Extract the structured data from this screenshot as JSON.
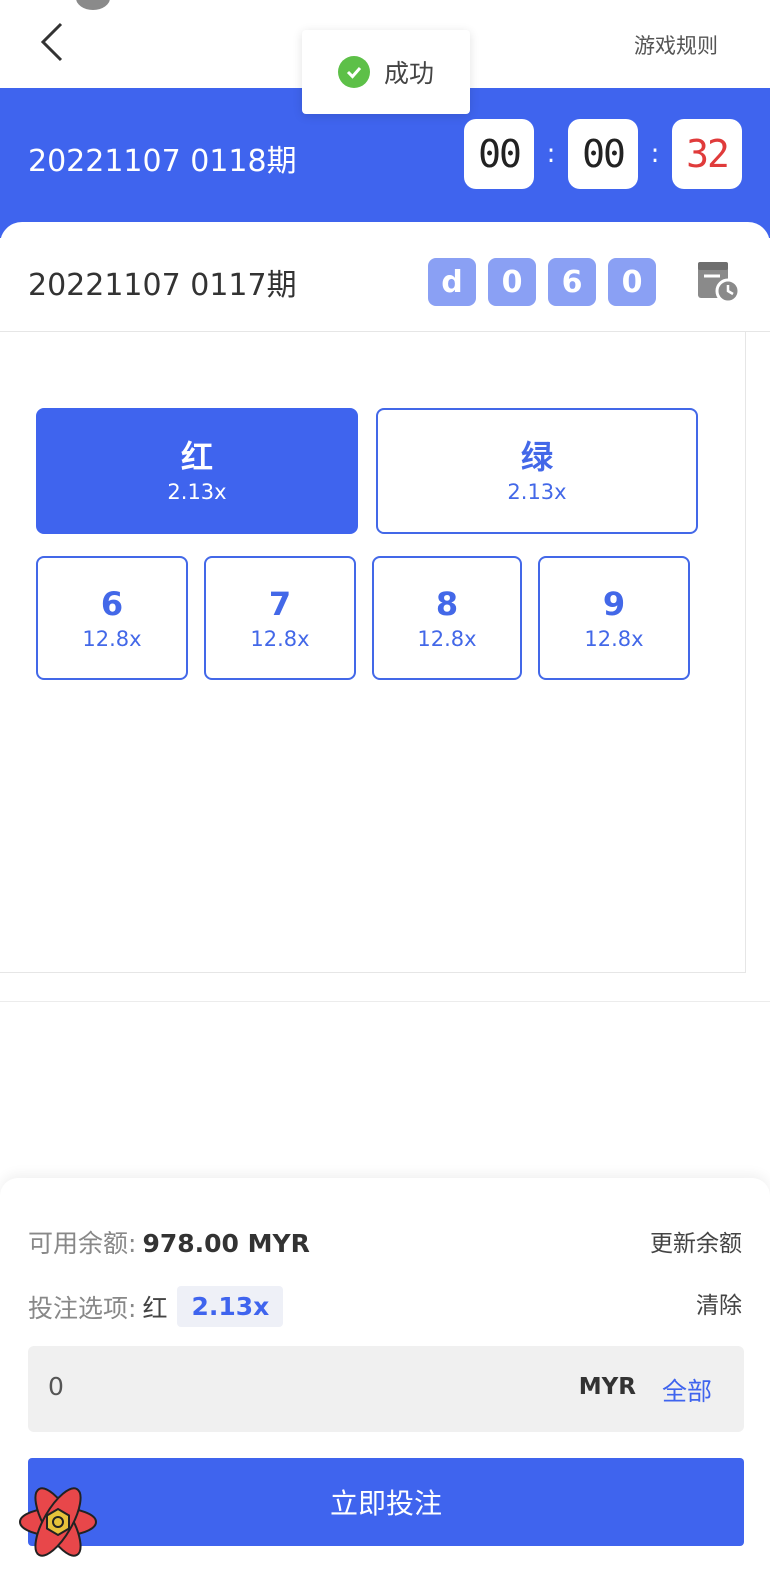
{
  "header": {
    "rules_label": "游戏规则"
  },
  "toast": {
    "message": "成功"
  },
  "current_round": {
    "period": "20221107 0118期",
    "timer": {
      "h": "00",
      "m": "00",
      "s": "32"
    }
  },
  "previous_round": {
    "period": "20221107 0117期",
    "results": [
      "d",
      "0",
      "6",
      "0"
    ]
  },
  "options": {
    "colors": [
      {
        "label": "红",
        "odds": "2.13x",
        "selected": true
      },
      {
        "label": "绿",
        "odds": "2.13x",
        "selected": false
      }
    ],
    "numbers": [
      {
        "label": "6",
        "odds": "12.8x"
      },
      {
        "label": "7",
        "odds": "12.8x"
      },
      {
        "label": "8",
        "odds": "12.8x"
      },
      {
        "label": "9",
        "odds": "12.8x"
      }
    ]
  },
  "bet_panel": {
    "balance_label": "可用余额:",
    "balance_value": "978.00 MYR",
    "refresh_label": "更新余额",
    "selection_label": "投注选项:",
    "selection_name": "红",
    "selection_odds": "2.13x",
    "clear_label": "清除",
    "amount_value": "0",
    "currency": "MYR",
    "all_label": "全部",
    "submit_label": "立即投注"
  },
  "colors": {
    "primary": "#3f64ee",
    "ball": "#8aa0f4",
    "timer_red": "#e03b3b",
    "success": "#5dc048"
  }
}
